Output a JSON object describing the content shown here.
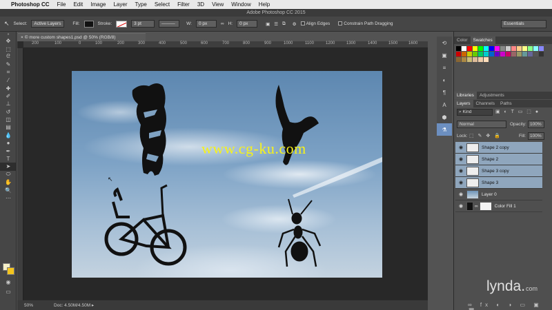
{
  "menubar": {
    "app": "Photoshop CC",
    "items": [
      "File",
      "Edit",
      "Image",
      "Layer",
      "Type",
      "Select",
      "Filter",
      "3D",
      "View",
      "Window",
      "Help"
    ]
  },
  "window_title": "Adobe Photoshop CC 2015",
  "options": {
    "select_label": "Select:",
    "select_value": "Active Layers",
    "fill_label": "Fill:",
    "stroke_label": "Stroke:",
    "stroke_width": "3 pt",
    "w_label": "W:",
    "w_value": "0 px",
    "h_label": "H:",
    "h_value": "0 px",
    "align_edges": "Align Edges",
    "constrain": "Constrain Path Dragging",
    "workspace": "Essentials"
  },
  "document": {
    "tab_title": "© more custom shapes1.psd @ 50% (RGB/8)",
    "watermark": "www.cg-ku.com",
    "zoom": "50%",
    "doc_size": "Doc: 4.50M/4.50M"
  },
  "ruler_h": [
    "200",
    "100",
    "0",
    "100",
    "200",
    "300",
    "400",
    "500",
    "600",
    "700",
    "800",
    "900",
    "1000",
    "1100",
    "1200",
    "1300",
    "1400",
    "1500",
    "1600",
    "1700"
  ],
  "panels": {
    "color_tab": "Color",
    "swatches_tab": "Swatches",
    "libraries_tab": "Libraries",
    "adjustments_tab": "Adjustments",
    "layers_tab": "Layers",
    "channels_tab": "Channels",
    "paths_tab": "Paths",
    "kind": "Kind",
    "blend_mode": "Normal",
    "opacity_label": "Opacity:",
    "opacity_value": "100%",
    "lock_label": "Lock:",
    "fill_label": "Fill:",
    "fill_value": "100%"
  },
  "layers": [
    {
      "name": "Shape 2 copy",
      "selected": true
    },
    {
      "name": "Shape 2",
      "selected": true
    },
    {
      "name": "Shape 3 copy",
      "selected": true
    },
    {
      "name": "Shape 3",
      "selected": true
    },
    {
      "name": "Layer 0",
      "selected": false
    },
    {
      "name": "Color Fill 1",
      "selected": false
    }
  ],
  "branding": {
    "name": "lynda",
    "tld": "com"
  },
  "colors": {
    "foreground": "#f5efc8",
    "background": "#f3c41e",
    "selected_layer": "#8fa6bd",
    "watermark": "#f7f21a"
  }
}
